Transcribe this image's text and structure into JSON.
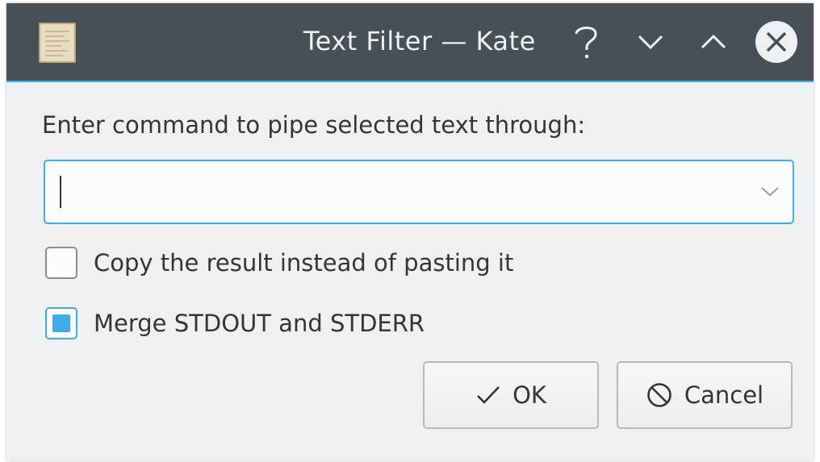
{
  "window": {
    "title": "Text Filter — Kate",
    "app_icon": "kate-text-editor-icon",
    "controls": {
      "help_icon": "question-mark-icon",
      "minimize_icon": "chevron-down-icon",
      "maximize_icon": "chevron-up-icon",
      "close_icon": "close-icon"
    }
  },
  "dialog": {
    "prompt": "Enter command to pipe selected text through:",
    "command_input": {
      "value": "",
      "placeholder": ""
    },
    "options": [
      {
        "label": "Copy the result instead of pasting it",
        "checked": false
      },
      {
        "label": "Merge STDOUT and STDERR",
        "checked": true
      }
    ],
    "buttons": {
      "ok_label": "OK",
      "ok_icon": "checkmark-icon",
      "cancel_label": "Cancel",
      "cancel_icon": "cancel-circle-icon"
    }
  },
  "colors": {
    "titlebar": "#475057",
    "accent": "#3daee9",
    "window_bg": "#eff0f1",
    "text": "#31363b"
  }
}
